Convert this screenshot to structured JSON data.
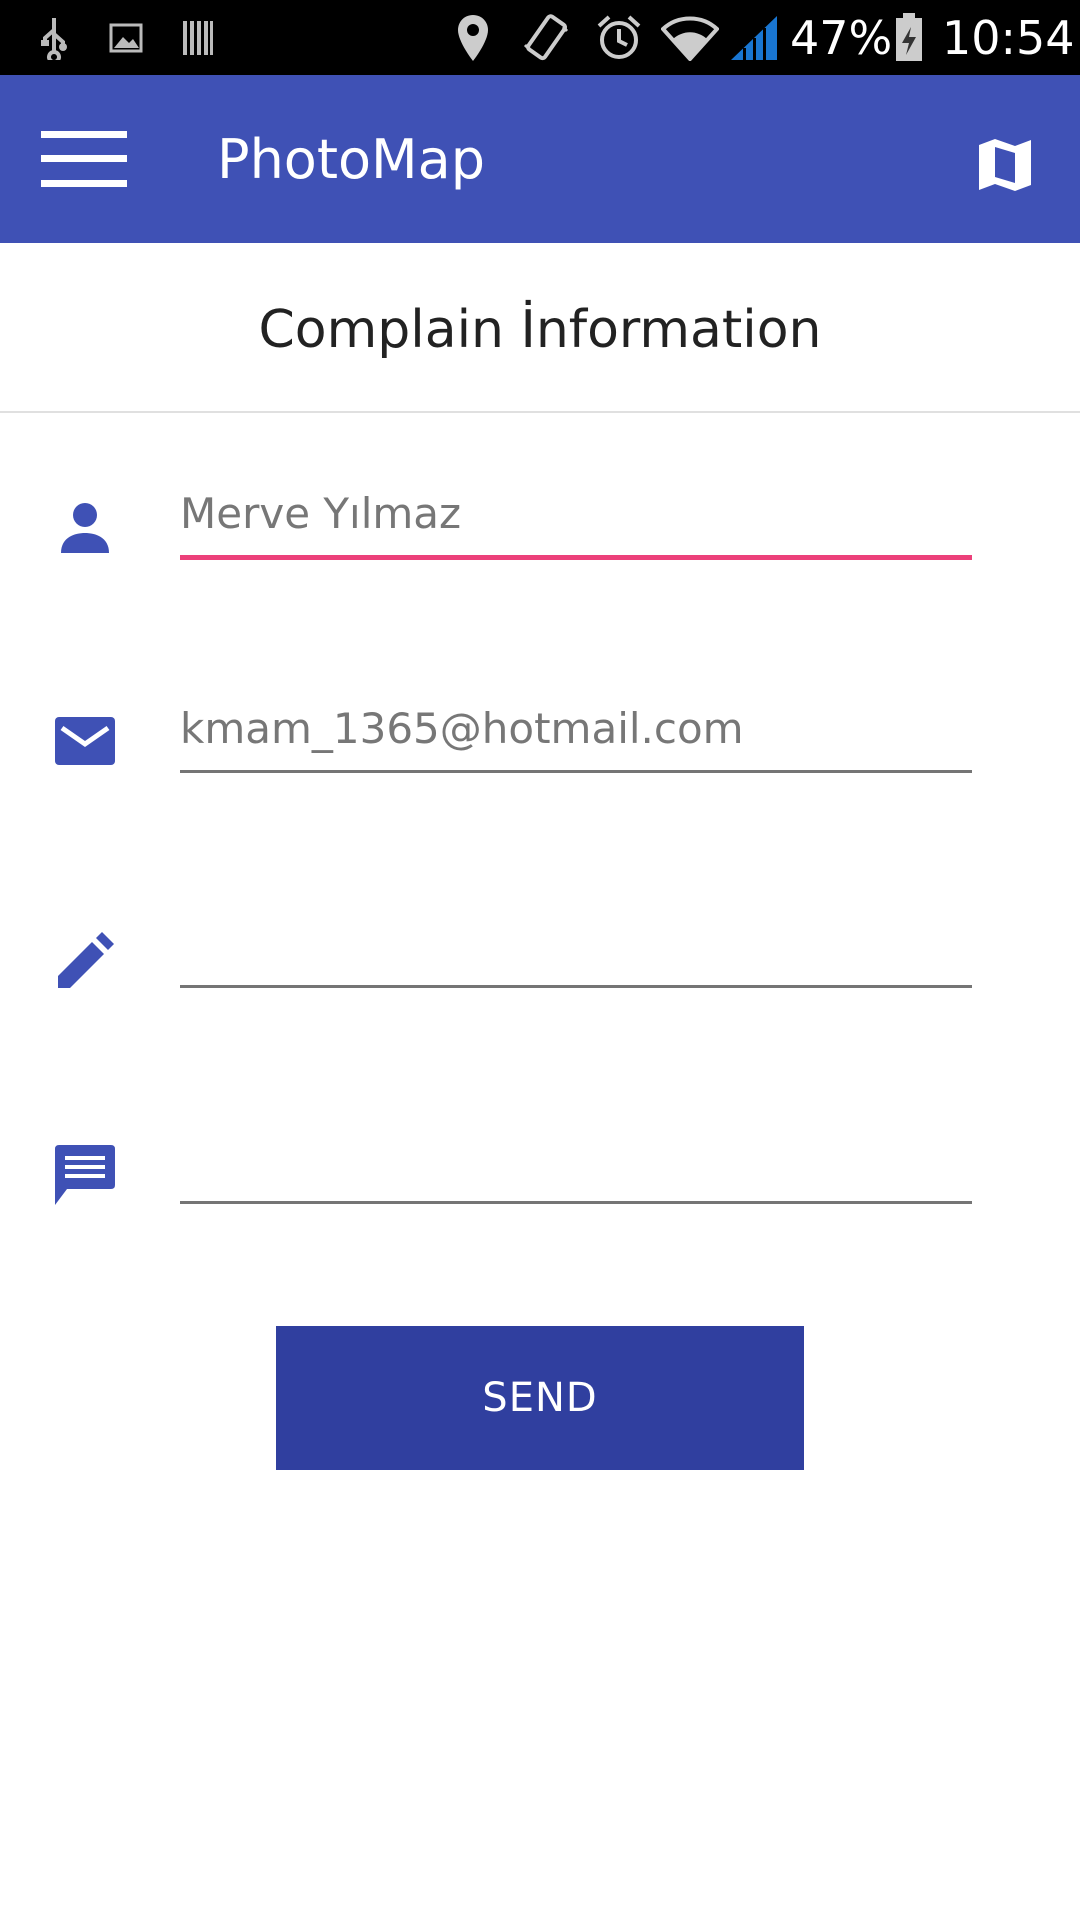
{
  "status_bar": {
    "battery": "47%",
    "time": "10:54",
    "icons": [
      "usb-icon",
      "image-icon",
      "barcode-icon",
      "location-icon",
      "vibrate-icon",
      "alarm-icon",
      "wifi-icon",
      "signal-icon",
      "battery-icon"
    ]
  },
  "app_bar": {
    "title": "PhotoMap",
    "menu_icon": "menu-icon",
    "map_icon": "map-icon",
    "color": "#3F51B5"
  },
  "page": {
    "title": "Complain İnformation"
  },
  "form": {
    "name_value": "Merve Yılmaz",
    "email_value": "kmam_1365@hotmail.com",
    "subject_value": "",
    "message_value": "",
    "focus_color": "#EC407A",
    "icon_color": "#3F51B5"
  },
  "send_button": {
    "label": "SEND",
    "color": "#303F9F"
  }
}
